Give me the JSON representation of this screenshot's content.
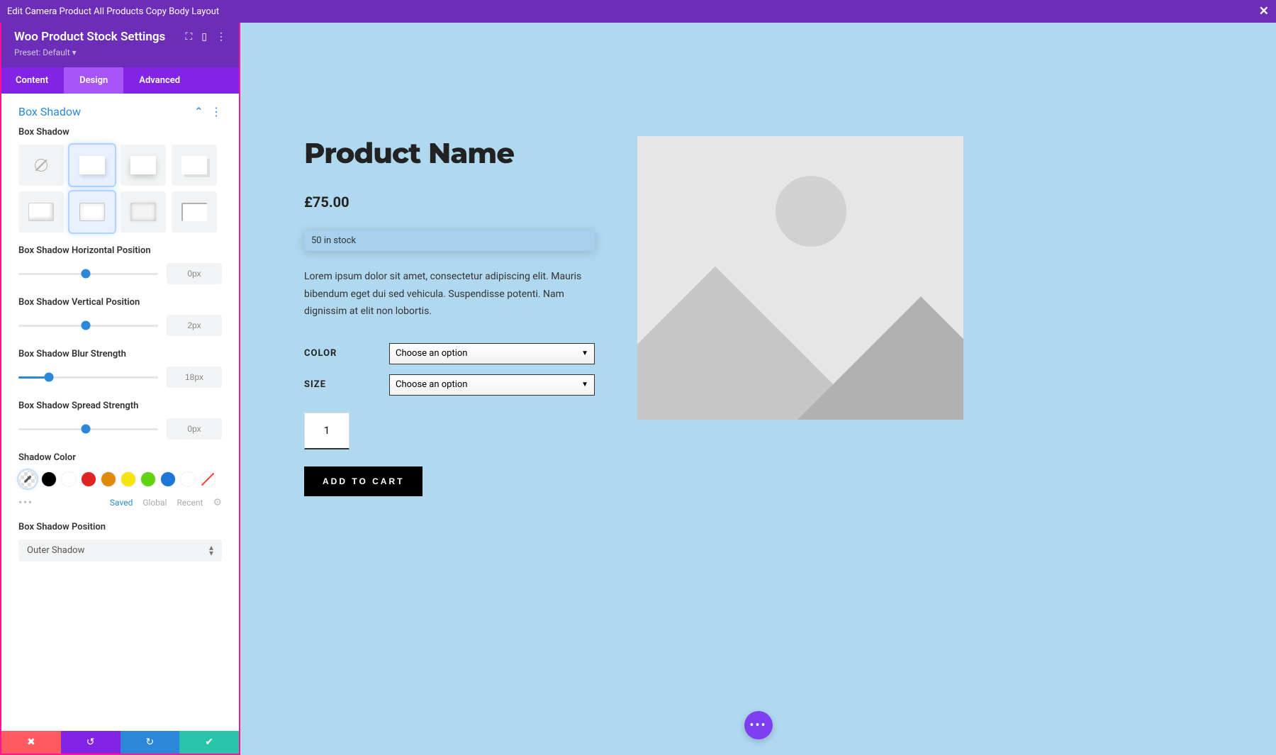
{
  "title_bar": "Edit Camera Product All Products Copy Body Layout",
  "sidebar": {
    "title": "Woo Product Stock Settings",
    "preset": "Preset: Default ▾",
    "tabs": {
      "content": "Content",
      "design": "Design",
      "advanced": "Advanced"
    }
  },
  "section": {
    "title": "Box Shadow"
  },
  "labels": {
    "presets": "Box Shadow",
    "horiz": "Box Shadow Horizontal Position",
    "vert": "Box Shadow Vertical Position",
    "blur": "Box Shadow Blur Strength",
    "spread": "Box Shadow Spread Strength",
    "color": "Shadow Color",
    "position": "Box Shadow Position"
  },
  "sliders": {
    "horiz": {
      "value": "0px",
      "pct": 48
    },
    "vert": {
      "value": "2px",
      "pct": 48
    },
    "blur": {
      "value": "18px",
      "pct": 22
    },
    "spread": {
      "value": "0px",
      "pct": 48
    }
  },
  "color_tabs": {
    "saved": "Saved",
    "global": "Global",
    "recent": "Recent"
  },
  "swatches": [
    "#000000",
    "#ffffff",
    "#e02424",
    "#e08a0b",
    "#f5e50a",
    "#5fd40e",
    "#1c77d6",
    "#ffffff"
  ],
  "position_select": "Outer Shadow",
  "preview": {
    "title": "Product Name",
    "price": "£75.00",
    "stock": "50 in stock",
    "desc": "Lorem ipsum dolor sit amet, consectetur adipiscing elit. Mauris bibendum eget dui sed vehicula. Suspendisse potenti. Nam dignissim at elit non lobortis.",
    "color_label": "COLOR",
    "size_label": "SIZE",
    "option_text": "Choose an option",
    "qty": "1",
    "add_cart": "ADD TO CART"
  }
}
